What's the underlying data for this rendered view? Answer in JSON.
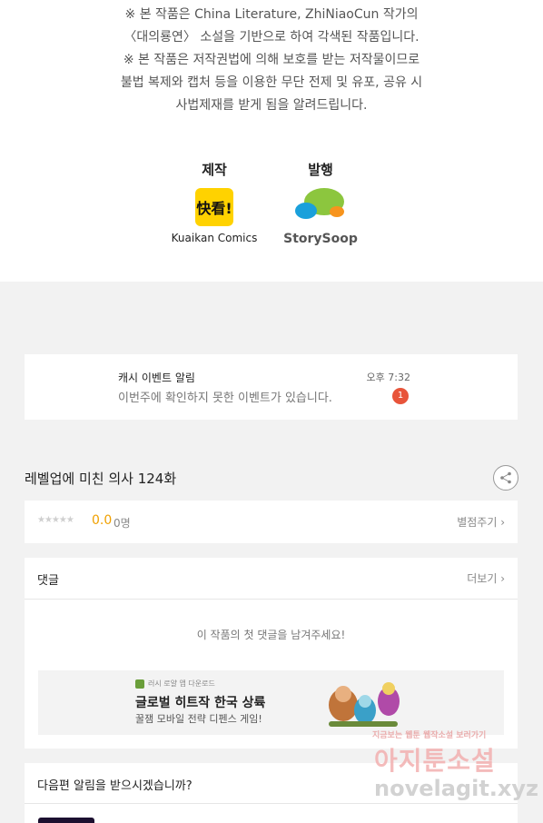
{
  "notice": {
    "lines": [
      "※ 본 작품은 China Literature, ZhiNiaoCun 작가의",
      "〈대의룡연〉 소설을 기반으로 하여 각색된 작품입니다.",
      "※ 본 작품은 저작권법에 의해 보호를 받는 저작물이므로",
      "불법 복제와 캡처 등을  이용한 무단 전제 및 유포, 공유 시",
      "사법제재를  받게 됨을 알려드립니다."
    ]
  },
  "credits": {
    "production": {
      "label": "제작",
      "logo_text": "快看!",
      "name": "Kuaikan Comics"
    },
    "publisher": {
      "label": "발행",
      "name": "StorySoop"
    }
  },
  "notification": {
    "title": "캐시 이벤트 알림",
    "text": "이번주에 확인하지 못한 이벤트가 있습니다.",
    "time": "오후 7:32",
    "badge": "1"
  },
  "episode": {
    "title": "레벨업에 미친 의사 124화",
    "share_icon": "share-icon"
  },
  "rating": {
    "stars": "★★★★★",
    "score": "0.0",
    "count": "0명",
    "rate_label": "별점주기 ›"
  },
  "comments": {
    "title": "댓글",
    "more_label": "더보기 ›",
    "empty_text": "이 작품의 첫 댓글을 남겨주세요!"
  },
  "ad": {
    "source": "러시 로얄 앱 다운로드",
    "title": "글로벌 히트작 한국 상륙",
    "subtitle": "꿀잼 모바일 전략 디펜스 게임!"
  },
  "next_episode": {
    "title": "다음편 알림을 받으시겠습니까?"
  },
  "watermark": {
    "top": "지금보는 웹툰 웹작소설 보러가기",
    "middle": "아지툰소설",
    "bottom": "novelagit.xyz"
  },
  "colors": {
    "badge": "#e8543a",
    "score": "#f0a000",
    "kuaikan": "#ffd200"
  }
}
